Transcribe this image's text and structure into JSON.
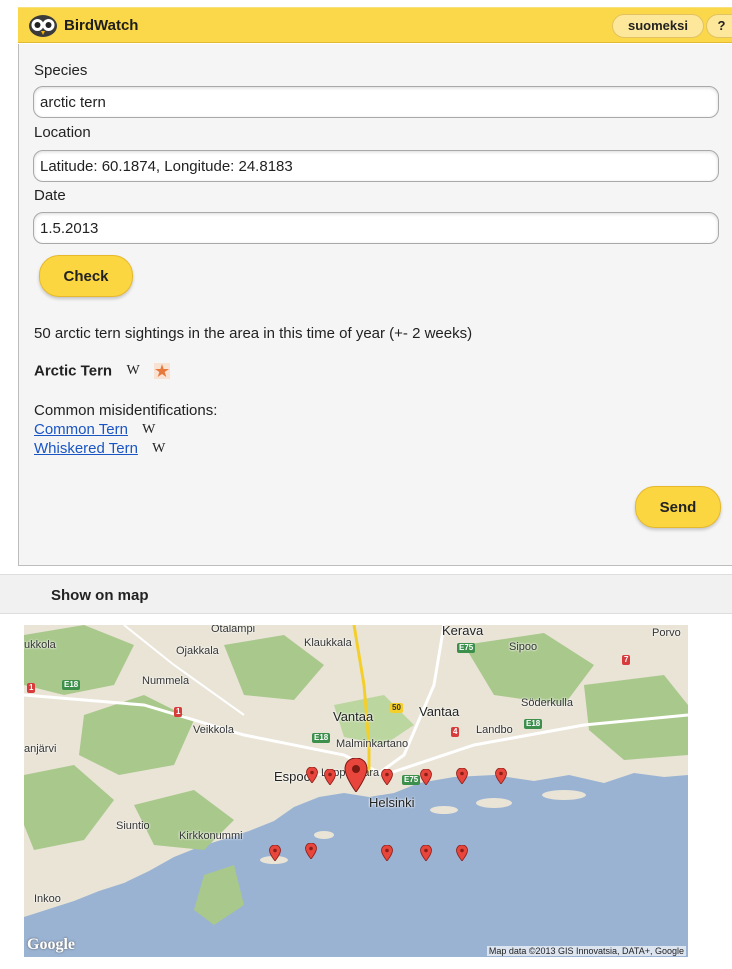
{
  "header": {
    "title": "BirdWatch",
    "language_label": "suomeksi",
    "help_label": "?",
    "accent_color": "#fbd84a"
  },
  "form": {
    "species_label": "Species",
    "species_value": "arctic tern",
    "location_label": "Location",
    "location_value": "Latitude: 60.1874, Longitude: 24.8183",
    "date_label": "Date",
    "date_value": "1.5.2013",
    "check_label": "Check"
  },
  "result": {
    "sightings_text": "50 arctic tern sightings in the area in this time of year (+- 2 weeks)",
    "species_name": "Arctic Tern",
    "wiki_glyph": "W",
    "misid_label": "Common misidentifications:",
    "misidentifications": [
      {
        "name": "Common Tern",
        "wiki_glyph": "W"
      },
      {
        "name": "Whiskered Tern",
        "wiki_glyph": "W"
      }
    ],
    "send_label": "Send"
  },
  "map": {
    "section_title": "Show on map",
    "places": {
      "otalampi": "Otalampi",
      "klaukkala": "Klaukkala",
      "kerava": "Kerava",
      "porvo": "Porvo",
      "ukkola": "ukkola",
      "ojakkala": "Ojakkala",
      "sipoo": "Sipoo",
      "nummela": "Nummela",
      "soderkulla": "Söderkulla",
      "vantaa1": "Vantaa",
      "vantaa2": "Vantaa",
      "veikkola": "Veikkola",
      "landbo": "Landbo",
      "malminkartano": "Malminkartano",
      "anjarvi": "anjärvi",
      "espoo": "Espoo",
      "leppavaara": "Leppävaara",
      "helsinki": "Helsinki",
      "siuntio": "Siuntio",
      "kirkkonummi": "Kirkkonummi",
      "inkoo": "Inkoo"
    },
    "road_shields": {
      "e18_a": "E18",
      "e18_b": "E18",
      "e18_c": "E18",
      "e75_a": "E75",
      "e75_b": "E75",
      "r1_a": "1",
      "r1_b": "1",
      "r4": "4",
      "r7": "7",
      "r50": "50"
    },
    "credit": "Map data ©2013 GIS Innovatsia, DATA+, Google",
    "google": "Google",
    "pin_color": "#e8463c"
  }
}
